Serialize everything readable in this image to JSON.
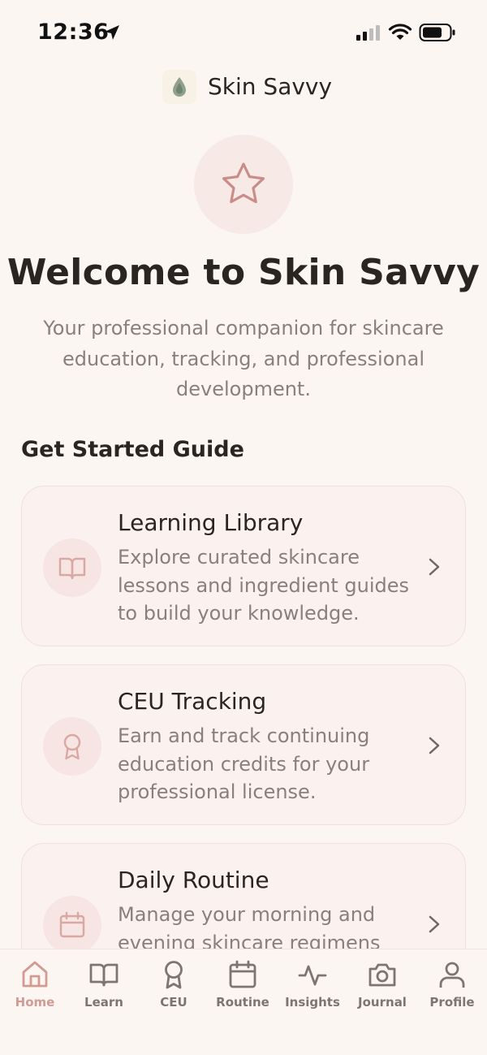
{
  "status_bar": {
    "time": "12:36",
    "icons": [
      "location-arrow-icon",
      "signal-icon",
      "wifi-icon",
      "battery-icon"
    ]
  },
  "header": {
    "app_name": "Skin Savvy",
    "logo_icon": "droplet-icon"
  },
  "hero": {
    "icon": "star-icon",
    "title": "Welcome to Skin Savvy",
    "subtitle": "Your professional companion for skincare education, tracking, and professional development."
  },
  "guide": {
    "heading": "Get Started Guide",
    "cards": [
      {
        "icon": "book-icon",
        "title": "Learning Library",
        "description": "Explore curated skincare lessons and ingredient guides to build your knowledge."
      },
      {
        "icon": "award-ribbon-icon",
        "title": "CEU Tracking",
        "description": "Earn and track continuing education credits for your professional license."
      },
      {
        "icon": "calendar-icon",
        "title": "Daily Routine",
        "description": "Manage your morning and evening skincare regimens"
      }
    ]
  },
  "tab_bar": {
    "active": "Home",
    "tabs": [
      {
        "label": "Home",
        "icon": "home-icon"
      },
      {
        "label": "Learn",
        "icon": "book-icon"
      },
      {
        "label": "CEU",
        "icon": "award-ribbon-icon"
      },
      {
        "label": "Routine",
        "icon": "calendar-icon"
      },
      {
        "label": "Insights",
        "icon": "activity-icon"
      },
      {
        "label": "Journal",
        "icon": "camera-icon"
      },
      {
        "label": "Profile",
        "icon": "user-icon"
      }
    ]
  },
  "colors": {
    "background": "#fcf6f2",
    "accent": "#d39a94",
    "card_background": "#fbf1ee",
    "text_primary": "#2a2523",
    "text_secondary": "#8a807b"
  }
}
